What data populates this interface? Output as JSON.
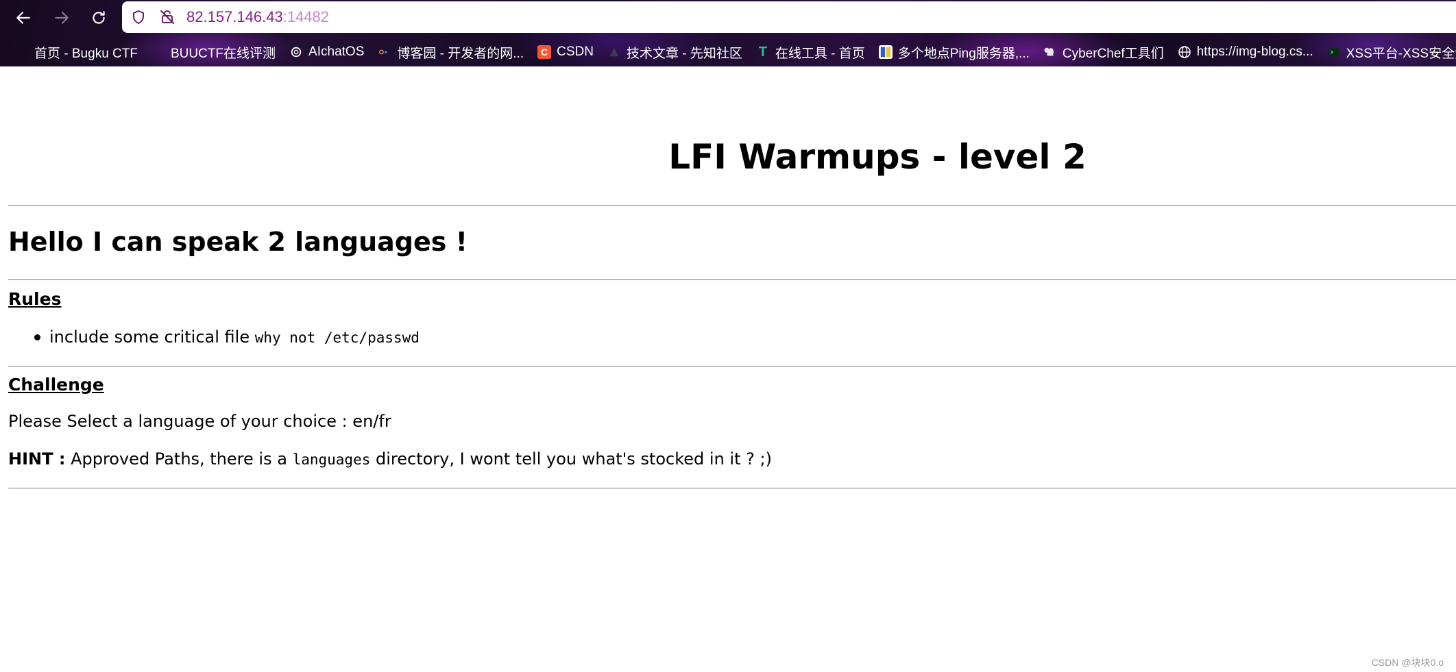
{
  "browser": {
    "url_host": "82.157.146.43",
    "url_port": ":14482",
    "bookmarks": [
      {
        "label": "首页 - Bugku CTF",
        "icon": "bugku-icon"
      },
      {
        "label": "BUUCTF在线评测",
        "icon": "buuctf-icon"
      },
      {
        "label": "AIchatOS",
        "icon": "openai-icon"
      },
      {
        "label": "博客园 - 开发者的网...",
        "icon": "cnblogs-icon"
      },
      {
        "label": "CSDN",
        "icon": "csdn-icon"
      },
      {
        "label": "技术文章 - 先知社区",
        "icon": "xianzhi-icon"
      },
      {
        "label": "在线工具 - 首页",
        "icon": "tools-icon"
      },
      {
        "label": "多个地点Ping服务器,...",
        "icon": "ping-icon"
      },
      {
        "label": "CyberChef工具们",
        "icon": "chef-hat-icon"
      },
      {
        "label": "https://img-blog.cs...",
        "icon": "globe-icon"
      },
      {
        "label": "XSS平台-XSS安全测",
        "icon": "xss-icon"
      }
    ]
  },
  "page": {
    "title": "LFI Warmups - level 2",
    "greeting": "Hello I can speak 2 languages !",
    "rules_heading": "Rules",
    "rule_text": "include some critical file ",
    "rule_code": "why not /etc/passwd",
    "challenge_heading": "Challenge",
    "select_text": "Please Select a language of your choice : en/fr",
    "hint_label": "HINT :",
    "hint_before": " Approved Paths, there is a ",
    "hint_code": "languages",
    "hint_after": " directory, I wont tell you what's stocked in it ? ;)"
  },
  "watermark": "CSDN @块块0.o",
  "colors": {
    "url_host": "#8a1f8a",
    "url_port": "#c78ac7",
    "rule_lines": "#777777"
  }
}
